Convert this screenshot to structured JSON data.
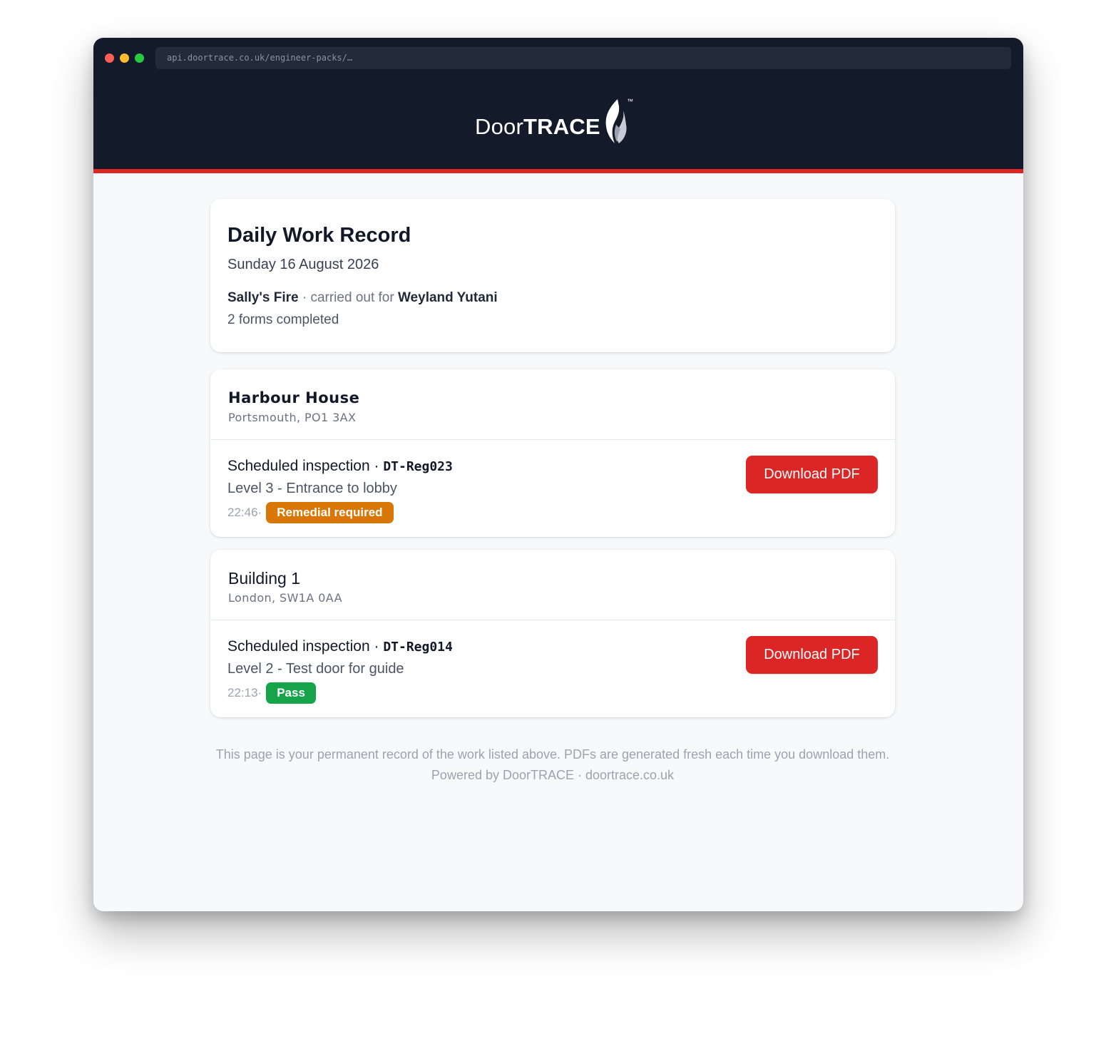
{
  "browser": {
    "url": "api.doortrace.co.uk/engineer-packs/…"
  },
  "brand": {
    "name_light": "Door",
    "name_bold": "TRACE",
    "trademark": "™"
  },
  "summary": {
    "title": "Daily Work Record",
    "date": "Sunday 16 August 2026",
    "company": "Sally's Fire",
    "carried_out_text": " · carried out for ",
    "client": "Weyland Yutani",
    "forms_completed": "2 forms completed"
  },
  "buildings": [
    {
      "name": "Harbour House",
      "address": "Portsmouth, PO1 3AX",
      "forms": [
        {
          "type": "Scheduled inspection",
          "separator": " · ",
          "ref": "DT-Reg023",
          "location": "Level 3 - Entrance to lobby",
          "time": "22:46",
          "meta_separator": " ·",
          "status": "Remedial required",
          "status_color": "#d97706",
          "download_label": "Download PDF"
        }
      ]
    },
    {
      "name": "Building 1",
      "address": "London, SW1A 0AA",
      "forms": [
        {
          "type": "Scheduled inspection",
          "separator": " · ",
          "ref": "DT-Reg014",
          "location": "Level 2 - Test door for guide",
          "time": "22:13",
          "meta_separator": " ·",
          "status": "Pass",
          "status_color": "#16a34a",
          "download_label": "Download PDF"
        }
      ]
    }
  ],
  "footer": {
    "line1": "This page is your permanent record of the work listed above. PDFs are generated fresh each time you download them.",
    "line2": "Powered by DoorTRACE · doortrace.co.uk"
  },
  "colors": {
    "header_bg": "#131a29",
    "accent_red": "#dc2626",
    "page_bg": "#f8f9fb"
  }
}
